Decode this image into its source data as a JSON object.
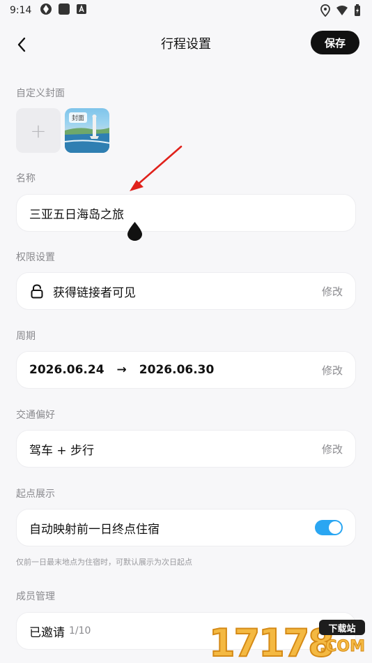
{
  "status_bar": {
    "time": "9:14"
  },
  "header": {
    "title": "行程设置",
    "save_label": "保存"
  },
  "cover": {
    "label": "自定义封面",
    "add_symbol": "+",
    "thumb_tag": "封面"
  },
  "name": {
    "label": "名称",
    "value": "三亚五日海岛之旅"
  },
  "permission": {
    "label": "权限设置",
    "value": "获得链接者可见",
    "edit_label": "修改"
  },
  "period": {
    "label": "周期",
    "start": "2026.06.24",
    "arrow": "→",
    "end": "2026.06.30",
    "edit_label": "修改"
  },
  "transport": {
    "label": "交通偏好",
    "value": "驾车 + 步行",
    "edit_label": "修改"
  },
  "start_point": {
    "label": "起点展示",
    "value": "自动映射前一日终点住宿",
    "toggle_on": true,
    "hint": "仅前一日最末地点为住宿时，可默认展示为次日起点"
  },
  "members": {
    "label": "成员管理",
    "value": "已邀请",
    "count": "1/10"
  },
  "watermark": {
    "digits": "17178",
    "badge": "下载站",
    "domain": ".COM"
  },
  "colors": {
    "accent": "#2aa6f2",
    "primary_button": "#111111",
    "annotation_arrow": "#e0211b"
  }
}
